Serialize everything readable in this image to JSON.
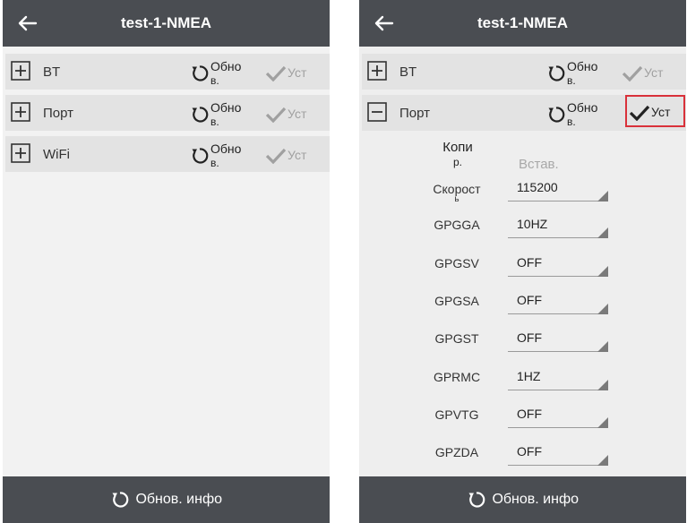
{
  "screens": [
    {
      "title": "test-1-NMEA",
      "rows": [
        {
          "label": "BT",
          "refresh_line1": "Обно",
          "refresh_line2": "в.",
          "set_label": "Уст"
        },
        {
          "label": "Порт",
          "refresh_line1": "Обно",
          "refresh_line2": "в.",
          "set_label": "Уст"
        },
        {
          "label": "WiFi",
          "refresh_line1": "Обно",
          "refresh_line2": "в.",
          "set_label": "Уст"
        }
      ],
      "bottom_label": "Обнов. инфо"
    },
    {
      "title": "test-1-NMEA",
      "rows": [
        {
          "label": "BT",
          "refresh_line1": "Обно",
          "refresh_line2": "в.",
          "set_label": "Уст"
        },
        {
          "label": "Порт",
          "refresh_line1": "Обно",
          "refresh_line2": "в.",
          "set_label": "Уст"
        }
      ],
      "copy_label_line1": "Копи",
      "copy_label_line2": "р.",
      "paste_label": "Встав.",
      "params": [
        {
          "label": "Скорост",
          "label_cont": "ь",
          "value": "115200"
        },
        {
          "label": "GPGGA",
          "value": "10HZ"
        },
        {
          "label": "GPGSV",
          "value": "OFF"
        },
        {
          "label": "GPGSA",
          "value": "OFF"
        },
        {
          "label": "GPGST",
          "value": "OFF"
        },
        {
          "label": "GPRMC",
          "value": "1HZ"
        },
        {
          "label": "GPVTG",
          "value": "OFF"
        },
        {
          "label": "GPZDA",
          "value": "OFF"
        }
      ],
      "bottom_label": "Обнов. инфо"
    }
  ],
  "colors": {
    "bar": "#4a4d52",
    "row_bg": "#e3e3e3",
    "highlight_border": "#d9313a",
    "disabled_text": "#a0a0a0"
  },
  "icons": [
    "back-arrow-icon",
    "plus-box-icon",
    "minus-box-icon",
    "refresh-icon",
    "checkmark-icon",
    "dropdown-triangle-icon"
  ]
}
